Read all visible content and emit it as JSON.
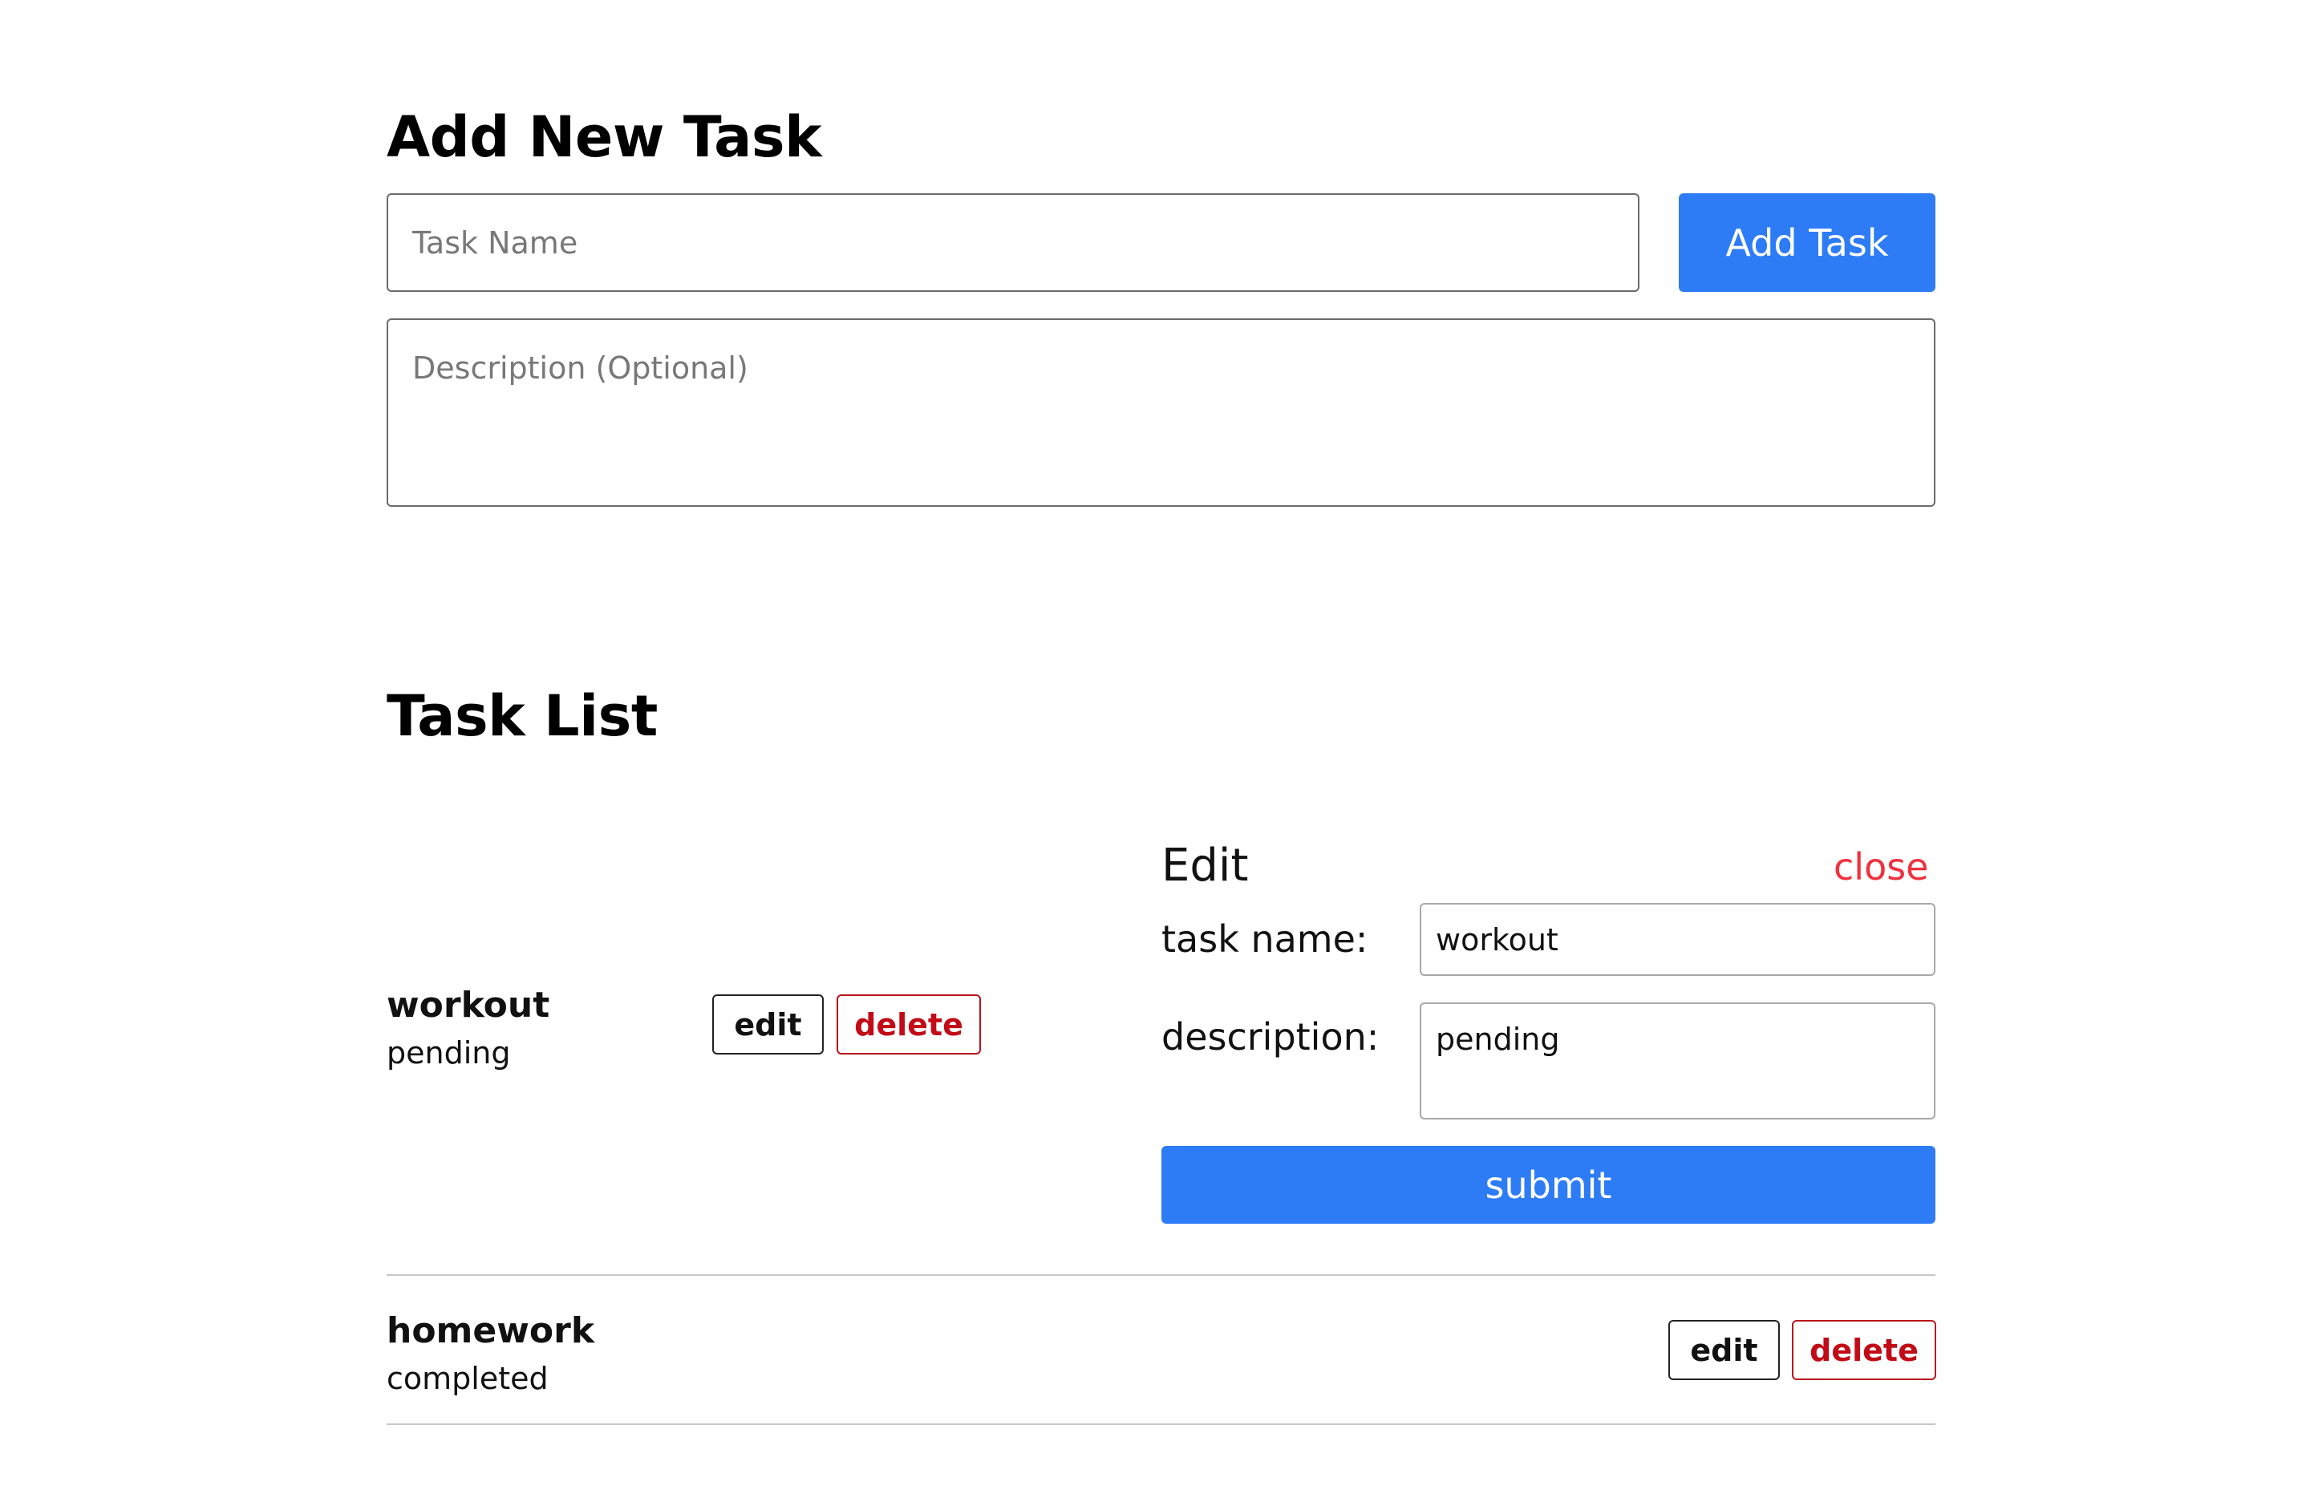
{
  "add_form": {
    "heading": "Add New Task",
    "task_name_placeholder": "Task Name",
    "description_placeholder": "Description (Optional)",
    "add_button_label": "Add Task"
  },
  "task_list": {
    "heading": "Task List",
    "tasks": [
      {
        "name": "workout",
        "status": "pending",
        "edit_label": "edit",
        "delete_label": "delete"
      },
      {
        "name": "homework",
        "status": "completed",
        "edit_label": "edit",
        "delete_label": "delete"
      }
    ]
  },
  "edit_panel": {
    "title": "Edit",
    "close_label": "close",
    "name_label": "task name:",
    "name_value": "workout",
    "description_label": "description:",
    "description_value": "pending",
    "submit_label": "submit"
  },
  "colors": {
    "primary": "#2d7cf6",
    "delete": "#c20b16",
    "close": "#f0313e",
    "divider": "#c8c8c8"
  }
}
